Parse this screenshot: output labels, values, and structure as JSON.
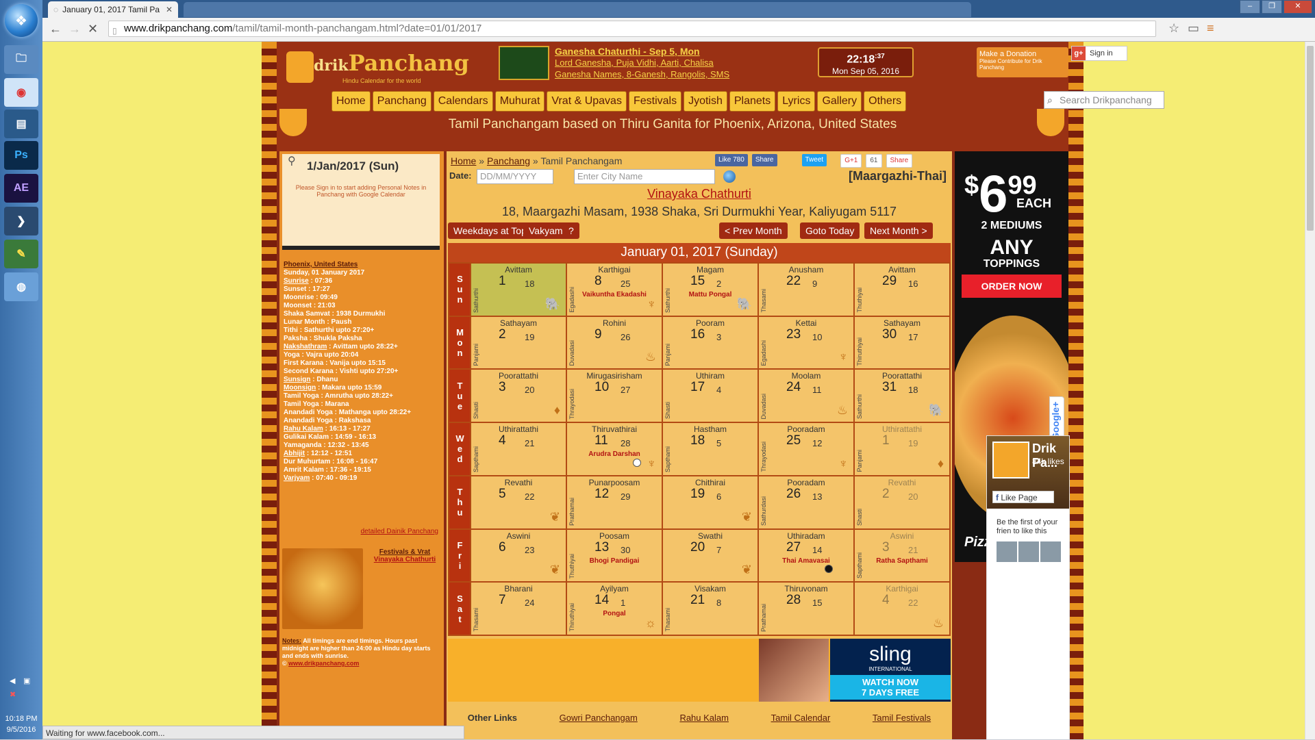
{
  "taskbar": {
    "time": "10:18 PM",
    "date": "9/5/2016"
  },
  "browser": {
    "tab_title": "January 01, 2017 Tamil Pa",
    "url_host": "www.drikpanchang.com",
    "url_rest": "/tamil/tamil-month-panchangam.html?date=01/01/2017",
    "status": "Waiting for www.facebook.com..."
  },
  "header": {
    "logo_drik": "drik",
    "logo_panchang": "Panchang",
    "tagline": "Hindu Calendar for the world",
    "fest_line1a": "Ganesha Chaturthi",
    "fest_line1b": "Sep 5, Mon",
    "fest_line2": [
      "Lord Ganesha",
      "Puja Vidhi",
      "Aarti",
      "Chalisa"
    ],
    "fest_line3": [
      "Ganesha Names",
      "8-Ganesh",
      "Rangolis",
      "SMS"
    ],
    "clock_time": "22:18",
    "clock_sec": ":37",
    "clock_date": "Mon Sep 05, 2016",
    "donate_title": "Make a Donation",
    "donate_sub": "Please Contribute for Drik Panchang",
    "signin": "Sign in",
    "search_placeholder": "Search Drikpanchang",
    "subtitle": "Tamil Panchangam based on Thiru Ganita for Phoenix, Arizona, United States",
    "menu": [
      "Home",
      "Panchang",
      "Calendars",
      "Muhurat",
      "Vrat & Upavas",
      "Festivals",
      "Jyotish",
      "Planets",
      "Lyrics",
      "Gallery",
      "Others"
    ]
  },
  "left": {
    "date_title": "1/Jan/2017 (Sun)",
    "note": "Please Sign in to start adding Personal Notes in Panchang with Google Calendar",
    "location": "Phoenix, United States",
    "day": "Sunday, 01 January 2017",
    "details": [
      {
        "k": "Sunrise",
        "sep": " : ",
        "v": "07:36",
        "u": true
      },
      {
        "k": "Sunset",
        "sep": " : ",
        "v": "17:27",
        "u": false
      },
      {
        "k": "Moonrise",
        "sep": " : ",
        "v": "09:49",
        "u": false
      },
      {
        "k": "Moonset",
        "sep": " : ",
        "v": "21:03",
        "u": false
      },
      {
        "k": "Shaka Samvat",
        "sep": " : ",
        "v": "1938 Durmukhi",
        "u": false
      },
      {
        "k": "Lunar Month",
        "sep": " : ",
        "v": "Paush",
        "u": false
      },
      {
        "k": "Tithi",
        "sep": " : ",
        "v": "Sathurthi upto 27:20+",
        "u": false
      },
      {
        "k": "Paksha",
        "sep": " : ",
        "v": "Shukla Paksha",
        "u": false
      },
      {
        "k": "Nakshathram",
        "sep": " : ",
        "v": "Avittam upto 28:22+",
        "u": true
      },
      {
        "k": "Yoga",
        "sep": " : ",
        "v": "Vajra upto 20:04",
        "u": false
      },
      {
        "k": "First Karana",
        "sep": " : ",
        "v": "Vanija upto 15:15",
        "u": false
      },
      {
        "k": "Second Karana",
        "sep": " : ",
        "v": "Vishti upto 27:20+",
        "u": false
      },
      {
        "k": "Sunsign",
        "sep": " : ",
        "v": "Dhanu",
        "u": true
      },
      {
        "k": "Moonsign",
        "sep": " : ",
        "v": "Makara upto 15:59",
        "u": true
      },
      {
        "k": "Tamil Yoga",
        "sep": " : ",
        "v": "Amrutha upto 28:22+",
        "u": false
      },
      {
        "k": "Tamil Yoga",
        "sep": " : ",
        "v": "Marana",
        "u": false
      },
      {
        "k": "Anandadi Yoga",
        "sep": " : ",
        "v": "Mathanga upto 28:22+",
        "u": false
      },
      {
        "k": "Anandadi Yoga",
        "sep": " : ",
        "v": "Rakshasa",
        "u": false
      },
      {
        "k": "Rahu Kalam",
        "sep": " : ",
        "v": "16:13 - 17:27",
        "u": true
      },
      {
        "k": "Gulikai Kalam",
        "sep": " : ",
        "v": "14:59 - 16:13",
        "u": false
      },
      {
        "k": "Yamaganda",
        "sep": " : ",
        "v": "12:32 - 13:45",
        "u": false
      },
      {
        "k": "Abhijit",
        "sep": " : ",
        "v": "12:12 - 12:51",
        "u": true
      },
      {
        "k": "Dur Muhurtam",
        "sep": " : ",
        "v": "16:08 - 16:47",
        "u": false
      },
      {
        "k": "Amrit Kalam",
        "sep": " : ",
        "v": "17:36 - 19:15",
        "u": false
      },
      {
        "k": "Varjyam",
        "sep": " : ",
        "v": "07:40 - 09:19",
        "u": true
      }
    ],
    "detail_link": "detailed Dainik Panchang",
    "festvrat_heading": "Festivals & Vrat",
    "festvrat_item": "Vinayaka Chathurti",
    "notes_key": "Notes:",
    "notes_text": "All timings are end timings. Hours past midnight are higher than 24:00 as Hindu day starts and ends with sunrise.",
    "notes_link": "www.drikpanchang.com"
  },
  "main": {
    "crumb_home": "Home",
    "crumb_panchang": "Panchang",
    "crumb_current": "Tamil Panchangam",
    "fb_like": "Like 780",
    "fb_share": "Share",
    "tweet": "Tweet",
    "gplus": "G+1",
    "gplus_count": "61",
    "gshare": "Share",
    "date_label": "Date:",
    "date_placeholder": "DD/MM/YYYY",
    "city_placeholder": "Enter City Name",
    "tamil_month": "[Maargazhi-Thai]",
    "vrat_title": "Vinayaka Chathurti",
    "tamil_date": "18, Maargazhi Masam, 1938 Shaka, Sri Durmukhi Year, Kaliyugam 5117",
    "btn_weekdays": "Weekdays at Top",
    "btn_vakyam": "Vakyam",
    "btn_help": "?",
    "btn_prev": "< Prev Month",
    "btn_today": "Goto Today",
    "btn_next": "Next Month >",
    "calendar_title": "January 01, 2017 (Sunday)",
    "weekdays": [
      "Sun",
      "Mon",
      "Tue",
      "Wed",
      "Thu",
      "Fri",
      "Sat"
    ],
    "rows": [
      [
        {
          "nak": "Avittam",
          "num": "1",
          "tnum": "18",
          "tithi": "Sathurthi",
          "fest": "",
          "sym": "ganesha",
          "hl": true
        },
        {
          "nak": "Karthigai",
          "num": "8",
          "tnum": "25",
          "tithi": "Egadashi",
          "fest": "Vaikuntha Ekadashi",
          "sym": "deity"
        },
        {
          "nak": "Magam",
          "num": "15",
          "tnum": "2",
          "tithi": "Sathurthi",
          "fest": "Mattu Pongal",
          "sym": "ganesha"
        },
        {
          "nak": "Anusham",
          "num": "22",
          "tnum": "9",
          "tithi": "Thasami",
          "fest": "",
          "sym": ""
        },
        {
          "nak": "Avittam",
          "num": "29",
          "tnum": "16",
          "tithi": "Thuthiyai",
          "fest": "",
          "sym": ""
        }
      ],
      [
        {
          "nak": "Sathayam",
          "num": "2",
          "tnum": "19",
          "tithi": "Panjami",
          "fest": "",
          "sym": ""
        },
        {
          "nak": "Rohini",
          "num": "9",
          "tnum": "26",
          "tithi": "Duvadasi",
          "fest": "",
          "sym": "lamp"
        },
        {
          "nak": "Pooram",
          "num": "16",
          "tnum": "3",
          "tithi": "Panjami",
          "fest": "",
          "sym": ""
        },
        {
          "nak": "Kettai",
          "num": "23",
          "tnum": "10",
          "tithi": "Egadashi",
          "fest": "",
          "sym": "deity"
        },
        {
          "nak": "Sathayam",
          "num": "30",
          "tnum": "17",
          "tithi": "Thiruthiyai",
          "fest": "",
          "sym": ""
        }
      ],
      [
        {
          "nak": "Poorattathi",
          "num": "3",
          "tnum": "20",
          "tithi": "Shasti",
          "fest": "",
          "sym": "flame"
        },
        {
          "nak": "Mirugasirisham",
          "num": "10",
          "tnum": "27",
          "tithi": "Thrayodasi",
          "fest": "",
          "sym": ""
        },
        {
          "nak": "Uthiram",
          "num": "17",
          "tnum": "4",
          "tithi": "Shasti",
          "fest": "",
          "sym": ""
        },
        {
          "nak": "Moolam",
          "num": "24",
          "tnum": "11",
          "tithi": "Duvadasi",
          "fest": "",
          "sym": "lamp"
        },
        {
          "nak": "Poorattathi",
          "num": "31",
          "tnum": "18",
          "tithi": "Sathurthi",
          "fest": "",
          "sym": "ganesha"
        }
      ],
      [
        {
          "nak": "Uthirattathi",
          "num": "4",
          "tnum": "21",
          "tithi": "Sapthami",
          "fest": "",
          "sym": ""
        },
        {
          "nak": "Thiruvathirai",
          "num": "11",
          "tnum": "28",
          "tithi": "",
          "fest": "Arudra Darshan",
          "sym": "deity",
          "moon": "white"
        },
        {
          "nak": "Hastham",
          "num": "18",
          "tnum": "5",
          "tithi": "Sapthami",
          "fest": "",
          "sym": ""
        },
        {
          "nak": "Pooradam",
          "num": "25",
          "tnum": "12",
          "tithi": "Thrayodasi",
          "fest": "",
          "sym": "deity"
        },
        {
          "nak": "Uthirattathi",
          "num": "1",
          "tnum": "19",
          "tithi": "Panjami",
          "fest": "",
          "sym": "flame",
          "dim": true
        }
      ],
      [
        {
          "nak": "Revathi",
          "num": "5",
          "tnum": "22",
          "tithi": "",
          "fest": "",
          "sym": "leaf"
        },
        {
          "nak": "Punarpoosam",
          "num": "12",
          "tnum": "29",
          "tithi": "Prathamai",
          "fest": "",
          "sym": ""
        },
        {
          "nak": "Chithirai",
          "num": "19",
          "tnum": "6",
          "tithi": "",
          "fest": "",
          "sym": "leaf"
        },
        {
          "nak": "Pooradam",
          "num": "26",
          "tnum": "13",
          "tithi": "Sathurdasi",
          "fest": "",
          "sym": ""
        },
        {
          "nak": "Revathi",
          "num": "2",
          "tnum": "20",
          "tithi": "Shasti",
          "fest": "",
          "sym": "",
          "dim": true
        }
      ],
      [
        {
          "nak": "Aswini",
          "num": "6",
          "tnum": "23",
          "tithi": "",
          "fest": "",
          "sym": "leaf"
        },
        {
          "nak": "Poosam",
          "num": "13",
          "tnum": "30",
          "tithi": "Thuthiyai",
          "fest": "Bhogi Pandigai",
          "sym": ""
        },
        {
          "nak": "Swathi",
          "num": "20",
          "tnum": "7",
          "tithi": "",
          "fest": "",
          "sym": "leaf"
        },
        {
          "nak": "Uthiradam",
          "num": "27",
          "tnum": "14",
          "tithi": "",
          "fest": "Thai Amavasai",
          "sym": "",
          "moon": "black"
        },
        {
          "nak": "Aswini",
          "num": "3",
          "tnum": "21",
          "tithi": "Sapthami",
          "fest": "Ratha Sapthami",
          "sym": "",
          "dim": true
        }
      ],
      [
        {
          "nak": "Bharani",
          "num": "7",
          "tnum": "24",
          "tithi": "Thasami",
          "fest": "",
          "sym": ""
        },
        {
          "nak": "Ayilyam",
          "num": "14",
          "tnum": "1",
          "tithi": "Thiruthiyai",
          "fest": "Pongal",
          "sym": "sun"
        },
        {
          "nak": "Visakam",
          "num": "21",
          "tnum": "8",
          "tithi": "Thasami",
          "fest": "",
          "sym": ""
        },
        {
          "nak": "Thiruvonam",
          "num": "28",
          "tnum": "15",
          "tithi": "Prathamai",
          "fest": "",
          "sym": ""
        },
        {
          "nak": "Karthigai",
          "num": "4",
          "tnum": "22",
          "tithi": "",
          "fest": "",
          "sym": "lamp",
          "dim": true
        }
      ]
    ],
    "other_links_heading": "Other Links",
    "other_links": [
      "Gowri Panchangam",
      "Rahu Kalam",
      "Tamil Calendar",
      "Tamil Festivals"
    ]
  },
  "ads": {
    "price_dollar": "$",
    "price_main": "6",
    "price_cents": "99",
    "each": "EACH",
    "line1": "2 MEDIUMS",
    "line2": "ANY",
    "line3": "TOPPINGS",
    "order": "ORDER NOW",
    "brand": "Pizza Hut",
    "sling": "sling",
    "sling_sub": "INTERNATIONAL",
    "sling_cta1": "WATCH NOW",
    "sling_cta2": "7 DAYS FREE"
  },
  "facebook": {
    "name": "Drik Pa...",
    "likes": "84k likes",
    "like_page": "Like Page",
    "first": "Be the first of your frien to like this"
  },
  "google_tab": "Google+"
}
